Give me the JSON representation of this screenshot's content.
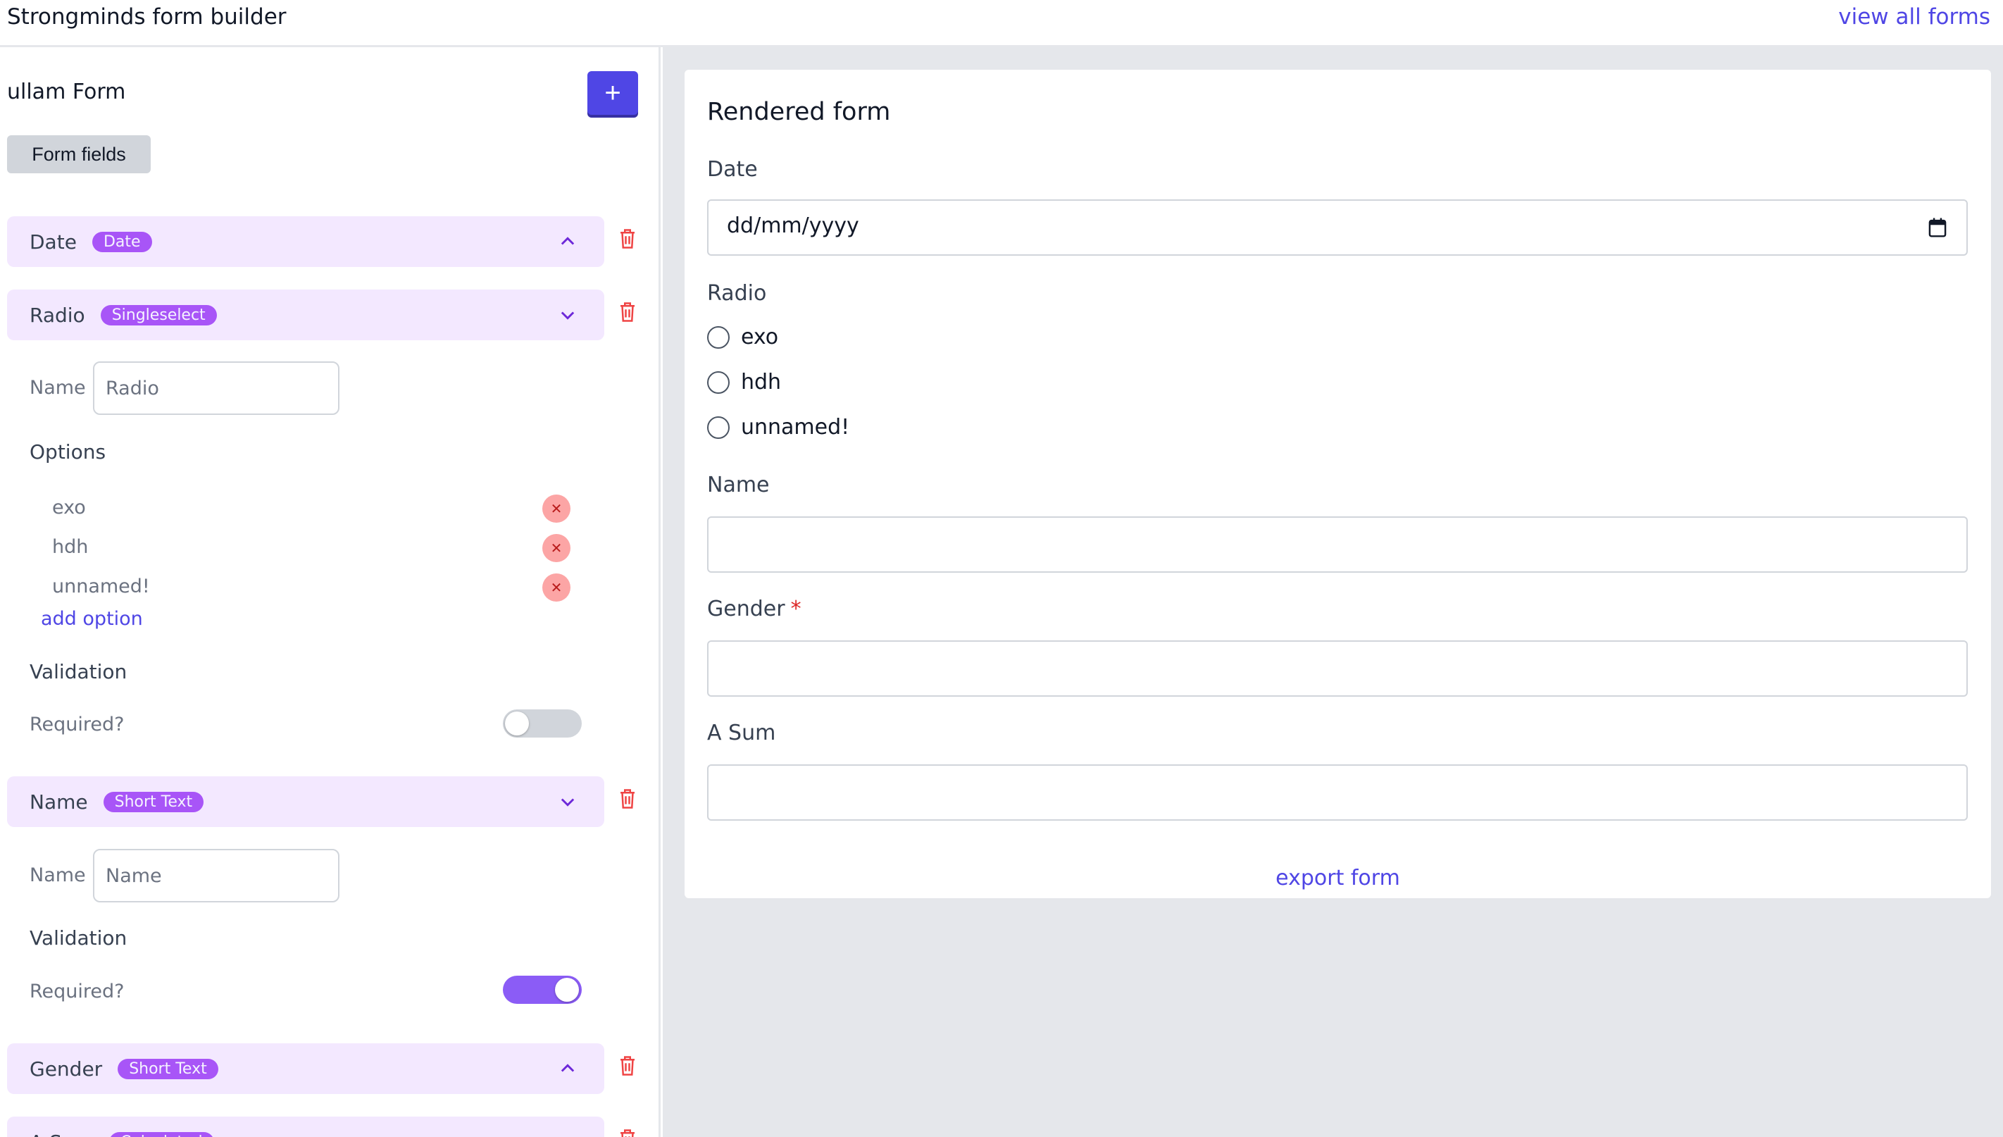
{
  "header": {
    "app_title": "Strongminds form builder",
    "view_all_label": "view all forms"
  },
  "builder": {
    "form_name": "ullam Form",
    "add_button_label": "+",
    "tab_label": "Form fields",
    "fields": [
      {
        "name": "Date",
        "type": "Date",
        "expanded": false
      },
      {
        "name": "Radio",
        "type": "Singleselect",
        "expanded": true
      },
      {
        "name": "Name",
        "type": "Short Text",
        "expanded": true
      },
      {
        "name": "Gender",
        "type": "Short Text",
        "expanded": false
      },
      {
        "name": "A Sum",
        "type": "Calculated",
        "expanded": false
      }
    ],
    "radio_editor": {
      "name_label": "Name",
      "name_value": "Radio",
      "options_title": "Options",
      "options": [
        "exo",
        "hdh",
        "unnamed!"
      ],
      "add_option_label": "add option",
      "validation_title": "Validation",
      "required_label": "Required?",
      "required": false
    },
    "name_editor": {
      "name_label": "Name",
      "name_value": "Name",
      "validation_title": "Validation",
      "required_label": "Required?",
      "required": true
    }
  },
  "rendered": {
    "title": "Rendered form",
    "date_label": "Date",
    "date_placeholder": "dd/mm/yyyy",
    "radio_label": "Radio",
    "radio_options": [
      "exo",
      "hdh",
      "unnamed!"
    ],
    "name_label": "Name",
    "gender_label": "Gender",
    "gender_required_mark": "*",
    "sum_label": "A Sum",
    "export_label": "export form"
  },
  "colors": {
    "accent": "#4f46e5",
    "badge": "#a855f7",
    "field_header_bg": "#f3e8ff",
    "danger": "#ef4444"
  }
}
